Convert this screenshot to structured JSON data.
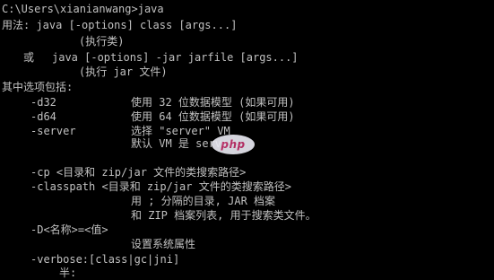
{
  "console": {
    "prompt_line": "C:\\Users\\xianianwang>java",
    "usage_line": "用法: java [-options] class [args...]",
    "usage_execclass": "(执行类)",
    "or_word": "或",
    "usage_jar": "java [-options] -jar jarfile [args...]",
    "usage_execjar": "(执行 jar 文件)",
    "options_header": "其中选项包括:",
    "options": [
      {
        "flag": "-d32",
        "desc": "使用 32 位数据模型 (如果可用)"
      },
      {
        "flag": "-d64",
        "desc": "使用 64 位数据模型 (如果可用)"
      },
      {
        "flag": "-server",
        "desc": "选择 \"server\" VM"
      }
    ],
    "server_default": "默认 VM 是 server.",
    "cp_line": "-cp <目录和 zip/jar 文件的类搜索路径>",
    "classpath_line": "-classpath <目录和 zip/jar 文件的类搜索路径>",
    "classpath_desc1": "用 ; 分隔的目录, JAR 档案",
    "classpath_desc2": "和 ZIP 档案列表, 用于搜索类文件。",
    "define_line": "-D<名称>=<值>",
    "define_desc": "设置系统属性",
    "verbose_line": "-verbose:[class|gc|jni]",
    "verbose_desc": "半:",
    "watermark_text": "php",
    "colors": {
      "background": "#000000",
      "text": "#c0c0c0",
      "watermark_bg": "#e8e8f0",
      "watermark_text": "#c0306a"
    }
  }
}
